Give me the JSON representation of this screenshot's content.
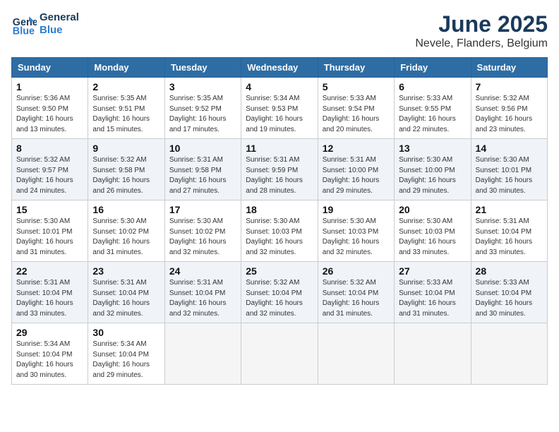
{
  "logo": {
    "line1": "General",
    "line2": "Blue"
  },
  "title": "June 2025",
  "location": "Nevele, Flanders, Belgium",
  "weekdays": [
    "Sunday",
    "Monday",
    "Tuesday",
    "Wednesday",
    "Thursday",
    "Friday",
    "Saturday"
  ],
  "weeks": [
    [
      {
        "day": 1,
        "sunrise": "5:36 AM",
        "sunset": "9:50 PM",
        "daylight": "16 hours and 13 minutes."
      },
      {
        "day": 2,
        "sunrise": "5:35 AM",
        "sunset": "9:51 PM",
        "daylight": "16 hours and 15 minutes."
      },
      {
        "day": 3,
        "sunrise": "5:35 AM",
        "sunset": "9:52 PM",
        "daylight": "16 hours and 17 minutes."
      },
      {
        "day": 4,
        "sunrise": "5:34 AM",
        "sunset": "9:53 PM",
        "daylight": "16 hours and 19 minutes."
      },
      {
        "day": 5,
        "sunrise": "5:33 AM",
        "sunset": "9:54 PM",
        "daylight": "16 hours and 20 minutes."
      },
      {
        "day": 6,
        "sunrise": "5:33 AM",
        "sunset": "9:55 PM",
        "daylight": "16 hours and 22 minutes."
      },
      {
        "day": 7,
        "sunrise": "5:32 AM",
        "sunset": "9:56 PM",
        "daylight": "16 hours and 23 minutes."
      }
    ],
    [
      {
        "day": 8,
        "sunrise": "5:32 AM",
        "sunset": "9:57 PM",
        "daylight": "16 hours and 24 minutes."
      },
      {
        "day": 9,
        "sunrise": "5:32 AM",
        "sunset": "9:58 PM",
        "daylight": "16 hours and 26 minutes."
      },
      {
        "day": 10,
        "sunrise": "5:31 AM",
        "sunset": "9:58 PM",
        "daylight": "16 hours and 27 minutes."
      },
      {
        "day": 11,
        "sunrise": "5:31 AM",
        "sunset": "9:59 PM",
        "daylight": "16 hours and 28 minutes."
      },
      {
        "day": 12,
        "sunrise": "5:31 AM",
        "sunset": "10:00 PM",
        "daylight": "16 hours and 29 minutes."
      },
      {
        "day": 13,
        "sunrise": "5:30 AM",
        "sunset": "10:00 PM",
        "daylight": "16 hours and 29 minutes."
      },
      {
        "day": 14,
        "sunrise": "5:30 AM",
        "sunset": "10:01 PM",
        "daylight": "16 hours and 30 minutes."
      }
    ],
    [
      {
        "day": 15,
        "sunrise": "5:30 AM",
        "sunset": "10:01 PM",
        "daylight": "16 hours and 31 minutes."
      },
      {
        "day": 16,
        "sunrise": "5:30 AM",
        "sunset": "10:02 PM",
        "daylight": "16 hours and 31 minutes."
      },
      {
        "day": 17,
        "sunrise": "5:30 AM",
        "sunset": "10:02 PM",
        "daylight": "16 hours and 32 minutes."
      },
      {
        "day": 18,
        "sunrise": "5:30 AM",
        "sunset": "10:03 PM",
        "daylight": "16 hours and 32 minutes."
      },
      {
        "day": 19,
        "sunrise": "5:30 AM",
        "sunset": "10:03 PM",
        "daylight": "16 hours and 32 minutes."
      },
      {
        "day": 20,
        "sunrise": "5:30 AM",
        "sunset": "10:03 PM",
        "daylight": "16 hours and 33 minutes."
      },
      {
        "day": 21,
        "sunrise": "5:31 AM",
        "sunset": "10:04 PM",
        "daylight": "16 hours and 33 minutes."
      }
    ],
    [
      {
        "day": 22,
        "sunrise": "5:31 AM",
        "sunset": "10:04 PM",
        "daylight": "16 hours and 33 minutes."
      },
      {
        "day": 23,
        "sunrise": "5:31 AM",
        "sunset": "10:04 PM",
        "daylight": "16 hours and 32 minutes."
      },
      {
        "day": 24,
        "sunrise": "5:31 AM",
        "sunset": "10:04 PM",
        "daylight": "16 hours and 32 minutes."
      },
      {
        "day": 25,
        "sunrise": "5:32 AM",
        "sunset": "10:04 PM",
        "daylight": "16 hours and 32 minutes."
      },
      {
        "day": 26,
        "sunrise": "5:32 AM",
        "sunset": "10:04 PM",
        "daylight": "16 hours and 31 minutes."
      },
      {
        "day": 27,
        "sunrise": "5:33 AM",
        "sunset": "10:04 PM",
        "daylight": "16 hours and 31 minutes."
      },
      {
        "day": 28,
        "sunrise": "5:33 AM",
        "sunset": "10:04 PM",
        "daylight": "16 hours and 30 minutes."
      }
    ],
    [
      {
        "day": 29,
        "sunrise": "5:34 AM",
        "sunset": "10:04 PM",
        "daylight": "16 hours and 30 minutes."
      },
      {
        "day": 30,
        "sunrise": "5:34 AM",
        "sunset": "10:04 PM",
        "daylight": "16 hours and 29 minutes."
      },
      null,
      null,
      null,
      null,
      null
    ]
  ]
}
